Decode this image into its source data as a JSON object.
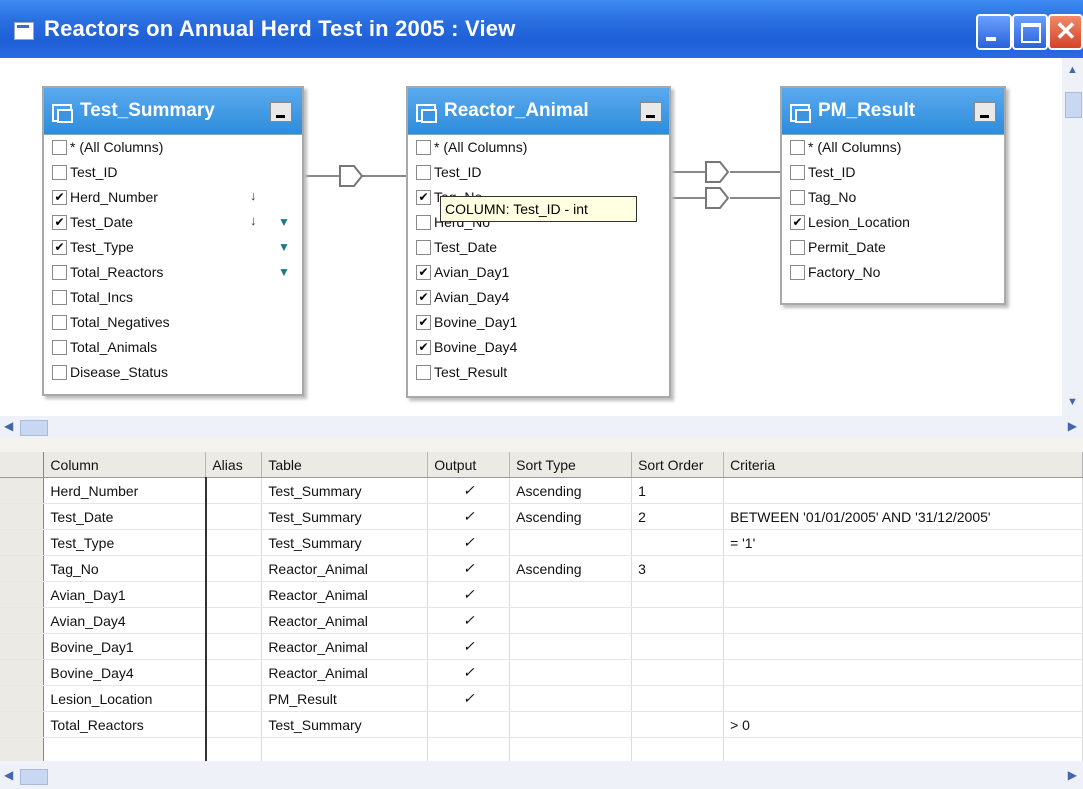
{
  "window": {
    "title": "Reactors on Annual Herd Test in 2005 : View",
    "titlebar_color": "#2a6fe0"
  },
  "tables": [
    {
      "name": "Test_Summary",
      "columns": [
        {
          "label": "* (All Columns)",
          "checked": false
        },
        {
          "label": "Test_ID",
          "checked": false
        },
        {
          "label": "Herd_Number",
          "checked": true,
          "sort": "↓",
          "filter": false
        },
        {
          "label": "Test_Date",
          "checked": true,
          "sort": "↓",
          "filter": true
        },
        {
          "label": "Test_Type",
          "checked": true,
          "filter": true
        },
        {
          "label": "Total_Reactors",
          "checked": false,
          "filter": true
        },
        {
          "label": "Total_Incs",
          "checked": false
        },
        {
          "label": "Total_Negatives",
          "checked": false
        },
        {
          "label": "Total_Animals",
          "checked": false
        },
        {
          "label": "Disease_Status",
          "checked": false
        }
      ]
    },
    {
      "name": "Reactor_Animal",
      "columns": [
        {
          "label": "* (All Columns)",
          "checked": false
        },
        {
          "label": "Test_ID",
          "checked": false
        },
        {
          "label": "Tag_No",
          "checked": true
        },
        {
          "label": "Herd_No",
          "checked": false
        },
        {
          "label": "Test_Date",
          "checked": false
        },
        {
          "label": "Avian_Day1",
          "checked": true
        },
        {
          "label": "Avian_Day4",
          "checked": true
        },
        {
          "label": "Bovine_Day1",
          "checked": true
        },
        {
          "label": "Bovine_Day4",
          "checked": true
        },
        {
          "label": "Test_Result",
          "checked": false
        }
      ]
    },
    {
      "name": "PM_Result",
      "columns": [
        {
          "label": "* (All Columns)",
          "checked": false
        },
        {
          "label": "Test_ID",
          "checked": false
        },
        {
          "label": "Tag_No",
          "checked": false
        },
        {
          "label": "Lesion_Location",
          "checked": true
        },
        {
          "label": "Permit_Date",
          "checked": false
        },
        {
          "label": "Factory_No",
          "checked": false
        }
      ]
    }
  ],
  "tooltip": "COLUMN: Test_ID - int",
  "grid": {
    "headers": [
      "Column",
      "Alias",
      "Table",
      "Output",
      "Sort Type",
      "Sort Order",
      "Criteria"
    ],
    "rows": [
      [
        "Herd_Number",
        "",
        "Test_Summary",
        "✓",
        "Ascending",
        "1",
        ""
      ],
      [
        "Test_Date",
        "",
        "Test_Summary",
        "✓",
        "Ascending",
        "2",
        "BETWEEN '01/01/2005' AND '31/12/2005'"
      ],
      [
        "Test_Type",
        "",
        "Test_Summary",
        "✓",
        "",
        "",
        "= '1'"
      ],
      [
        "Tag_No",
        "",
        "Reactor_Animal",
        "✓",
        "Ascending",
        "3",
        ""
      ],
      [
        "Avian_Day1",
        "",
        "Reactor_Animal",
        "✓",
        "",
        "",
        ""
      ],
      [
        "Avian_Day4",
        "",
        "Reactor_Animal",
        "✓",
        "",
        "",
        ""
      ],
      [
        "Bovine_Day1",
        "",
        "Reactor_Animal",
        "✓",
        "",
        "",
        ""
      ],
      [
        "Bovine_Day4",
        "",
        "Reactor_Animal",
        "✓",
        "",
        "",
        ""
      ],
      [
        "Lesion_Location",
        "",
        "PM_Result",
        "✓",
        "",
        "",
        ""
      ],
      [
        "Total_Reactors",
        "",
        "Test_Summary",
        "",
        "",
        "",
        "> 0"
      ],
      [
        "",
        "",
        "",
        "",
        "",
        "",
        ""
      ]
    ]
  },
  "icons": {
    "checkbox_mark": "✔",
    "scroll_left": "◀",
    "scroll_right": "▶",
    "scroll_up": "▲",
    "scroll_down": "▼",
    "filter": "▼"
  }
}
